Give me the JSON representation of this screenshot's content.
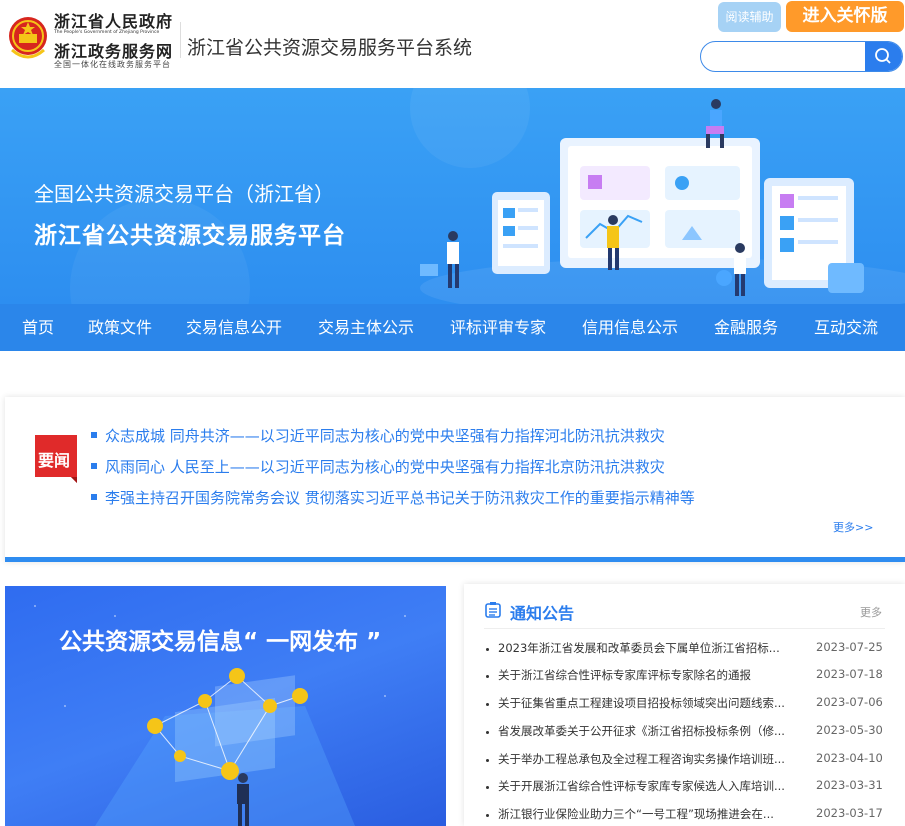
{
  "header": {
    "gov_name": "浙江省人民政府",
    "gov_name_en": "The People's Government of Zhejiang Province",
    "service_name": "浙江政务服务网",
    "service_slogan": "全国一体化在线政务服务平台",
    "platform_title": "浙江省公共资源交易服务平台系统",
    "reading_aid_label": "阅读辅助",
    "care_mode_label": "进入关怀版",
    "search_placeholder": "",
    "search_icon": "search-icon"
  },
  "banner": {
    "subtitle": "全国公共资源交易平台（浙江省）",
    "title": "浙江省公共资源交易服务平台"
  },
  "nav": {
    "items": [
      "首页",
      "政策文件",
      "交易信息公开",
      "交易主体公示",
      "评标评审专家",
      "信用信息公示",
      "金融服务",
      "互动交流"
    ]
  },
  "news": {
    "badge": "要闻",
    "items": [
      "众志成城 同舟共济——以习近平同志为核心的党中央坚强有力指挥河北防汛抗洪救灾",
      "风雨同心 人民至上——以习近平同志为核心的党中央坚强有力指挥北京防汛抗洪救灾",
      "李强主持召开国务院常务会议  贯彻落实习近平总书记关于防汛救灾工作的重要指示精神等"
    ],
    "more_label": "更多>>"
  },
  "feature": {
    "title": "公共资源交易信息“ 一网发布 ”"
  },
  "notices": {
    "title": "通知公告",
    "more_label": "更多",
    "items": [
      {
        "text": "2023年浙江省发展和改革委员会下属单位浙江省招标...",
        "date": "2023-07-25"
      },
      {
        "text": "关于浙江省综合性评标专家库评标专家除名的通报",
        "date": "2023-07-18"
      },
      {
        "text": "关于征集省重点工程建设项目招投标领域突出问题线索...",
        "date": "2023-07-06"
      },
      {
        "text": "省发展改革委关于公开征求《浙江省招标投标条例（修...",
        "date": "2023-05-30"
      },
      {
        "text": "关于举办工程总承包及全过程工程咨询实务操作培训班...",
        "date": "2023-04-10"
      },
      {
        "text": "关于开展浙江省综合性评标专家库专家候选人入库培训...",
        "date": "2023-03-31"
      },
      {
        "text": "浙江银行业保险业助力三个“一号工程”现场推进会在...",
        "date": "2023-03-17"
      }
    ]
  },
  "colors": {
    "primary": "#2b7ded",
    "banner": "#3aa1f5",
    "care_button": "#ff9a2a",
    "badge_red": "#e02a2a"
  }
}
